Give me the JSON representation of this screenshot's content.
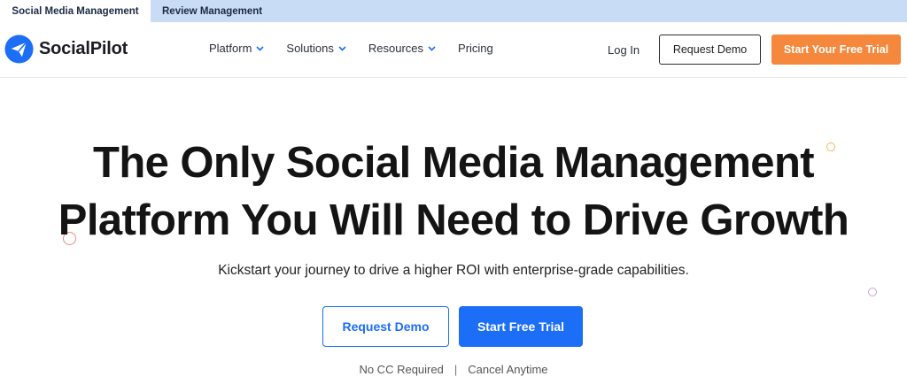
{
  "product_tabs": [
    {
      "label": "Social Media Management",
      "active": true
    },
    {
      "label": "Review Management",
      "active": false
    }
  ],
  "brand": {
    "name": "SocialPilot",
    "icon": "paper-plane-icon",
    "color": "#1b6ef5"
  },
  "nav": {
    "items": [
      {
        "label": "Platform",
        "has_dropdown": true
      },
      {
        "label": "Solutions",
        "has_dropdown": true
      },
      {
        "label": "Resources",
        "has_dropdown": true
      },
      {
        "label": "Pricing",
        "has_dropdown": false
      }
    ],
    "login": "Log In",
    "request_demo": "Request Demo",
    "free_trial": "Start Your Free Trial"
  },
  "hero": {
    "headline_line1": "The Only Social Media Management",
    "headline_line2": "Platform You Will Need to Drive Growth",
    "subtitle": "Kickstart your journey to drive a higher ROI with enterprise-grade capabilities.",
    "request_demo": "Request Demo",
    "start_trial": "Start Free Trial",
    "note_1": "No CC Required",
    "separator": "|",
    "note_2": "Cancel Anytime"
  },
  "colors": {
    "primary_blue": "#1b6ef5",
    "accent_orange": "#f5883d",
    "topbar_bg": "#c9dcf6"
  }
}
